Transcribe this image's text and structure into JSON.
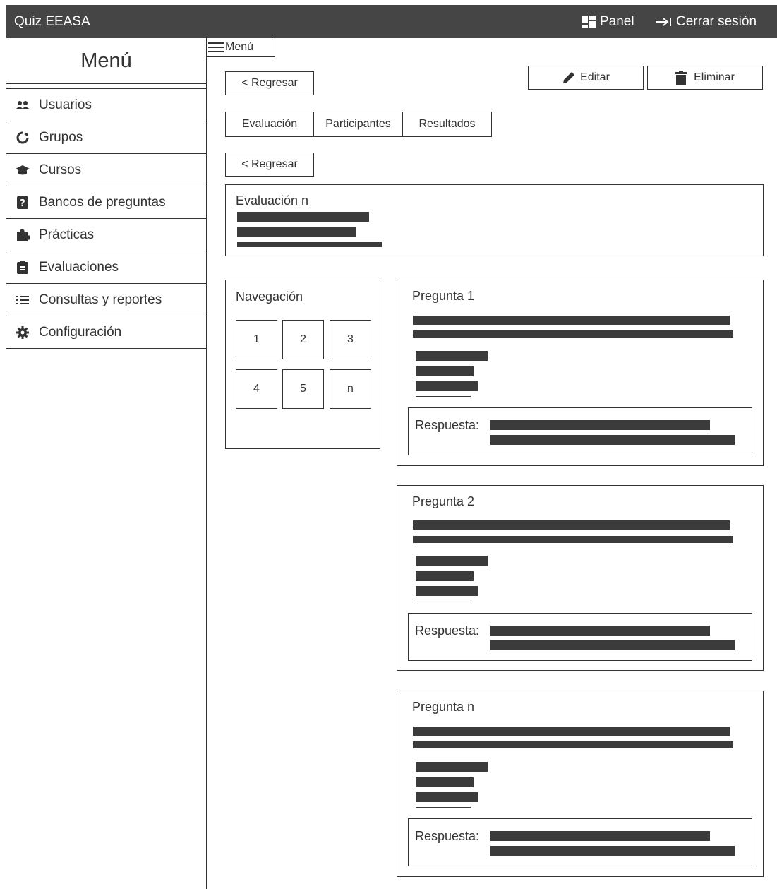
{
  "topbar": {
    "title": "Quiz EEASA",
    "panel": "Panel",
    "logout": "Cerrar sesión"
  },
  "menu_toggle": "Menú",
  "sidebar": {
    "title": "Menú",
    "items": [
      {
        "label": "Usuarios",
        "icon": "users-icon"
      },
      {
        "label": "Grupos",
        "icon": "circle-notch-icon"
      },
      {
        "label": "Cursos",
        "icon": "graduation-cap-icon"
      },
      {
        "label": "Bancos de preguntas",
        "icon": "question-square-icon"
      },
      {
        "label": "Prácticas",
        "icon": "puzzle-icon"
      },
      {
        "label": "Evaluaciones",
        "icon": "clipboard-icon"
      },
      {
        "label": "Consultas y reportes",
        "icon": "list-icon"
      },
      {
        "label": "Configuración",
        "icon": "gear-icon"
      }
    ]
  },
  "actions": {
    "back": "< Regresar",
    "edit": "Editar",
    "delete": "Eliminar",
    "back2": "< Regresar"
  },
  "tabs": [
    "Evaluación",
    "Participantes",
    "Resultados"
  ],
  "evaluation": {
    "title": "Evaluación n"
  },
  "navigation": {
    "title": "Navegación",
    "items": [
      "1",
      "2",
      "3",
      "4",
      "5",
      "n"
    ]
  },
  "questions": [
    {
      "title": "Pregunta 1",
      "answer_label": "Respuesta:"
    },
    {
      "title": "Pregunta 2",
      "answer_label": "Respuesta:"
    },
    {
      "title": "Pregunta n",
      "answer_label": "Respuesta:"
    }
  ]
}
